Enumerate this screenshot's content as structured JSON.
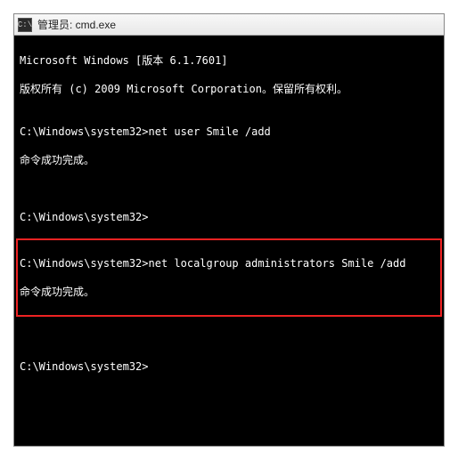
{
  "titlebar": {
    "icon_label": "C:\\",
    "title": "管理员: cmd.exe"
  },
  "terminal": {
    "line1": "Microsoft Windows [版本 6.1.7601]",
    "line2": "版权所有 (c) 2009 Microsoft Corporation。保留所有权利。",
    "blank": "",
    "prompt1": "C:\\Windows\\system32>",
    "cmd1": "net user Smile /add",
    "result1": "命令成功完成。",
    "prompt2": "C:\\Windows\\system32>",
    "prompt3": "C:\\Windows\\system32>",
    "cmd3": "net localgroup administrators Smile /add",
    "result3": "命令成功完成。",
    "prompt4": "C:\\Windows\\system32>"
  }
}
